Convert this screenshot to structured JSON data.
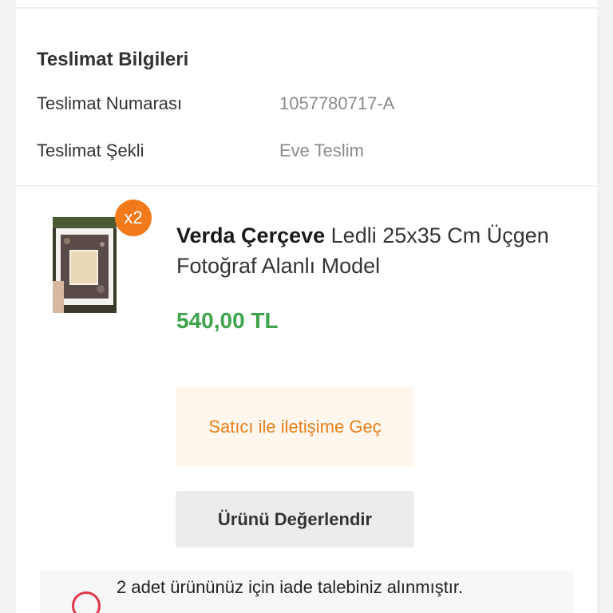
{
  "delivery": {
    "title": "Teslimat Bilgileri",
    "number_label": "Teslimat Numarası",
    "number_value": "1057780717-A",
    "method_label": "Teslimat Şekli",
    "method_value": "Eve Teslim"
  },
  "product": {
    "quantity_badge": "x2",
    "brand": "Verda Çerçeve",
    "name": "Ledli 25x35 Cm Üçgen Fotoğraf Alanlı Model",
    "price": "540,00 TL",
    "contact_seller_label": "Satıcı ile iletişime Geç",
    "review_label": "Ürünü Değerlendir"
  },
  "return_notice": {
    "text": "2 adet ürününüz için iade talebiniz alınmıştır."
  },
  "colors": {
    "accent_orange": "#f27a1a",
    "price_green": "#3fa34d",
    "return_red": "#e0374b"
  }
}
